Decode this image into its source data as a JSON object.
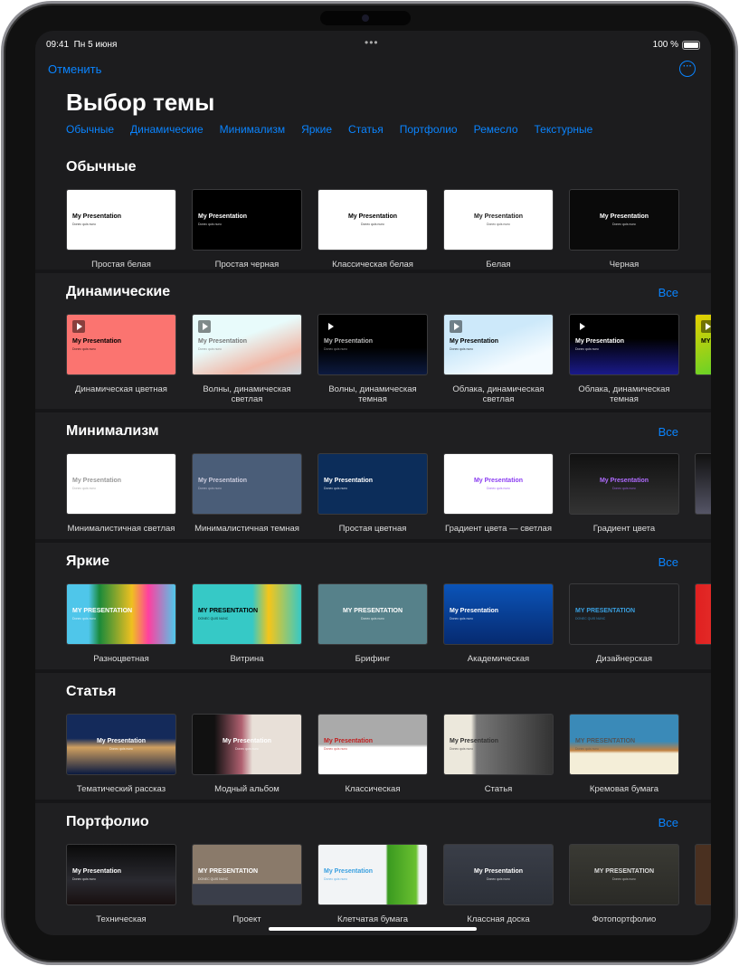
{
  "status": {
    "time": "09:41",
    "date": "Пн 5 июня",
    "dots": "•••",
    "battery": "100 %"
  },
  "nav": {
    "cancel": "Отменить",
    "more_icon": "ellipsis-circle-icon"
  },
  "title": "Выбор темы",
  "categories": [
    "Обычные",
    "Динамические",
    "Минимализм",
    "Яркие",
    "Статья",
    "Портфолио",
    "Ремесло",
    "Текстурные"
  ],
  "all_label": "Все",
  "sections": [
    {
      "title": "Обычные",
      "show_all": false,
      "themes": [
        {
          "label": "Простая белая",
          "bg": "#ffffff",
          "fg": "#000",
          "title": "My Presentation",
          "subtitle": "Donec quis nunc"
        },
        {
          "label": "Простая черная",
          "bg": "#000000",
          "fg": "#fff",
          "title": "My Presentation",
          "subtitle": "Donec quis nunc"
        },
        {
          "label": "Классическая белая",
          "bg": "#ffffff",
          "fg": "#000",
          "title": "My Presentation",
          "subtitle": "Donec quis nunc",
          "center": true
        },
        {
          "label": "Белая",
          "bg": "#ffffff",
          "fg": "#222",
          "title": "My Presentation",
          "subtitle": "Donec quis nunc",
          "center": true
        },
        {
          "label": "Черная",
          "bg": "#0a0a0a",
          "fg": "#fff",
          "title": "My Presentation",
          "subtitle": "Donec quis nunc",
          "center": true
        }
      ]
    },
    {
      "title": "Динамические",
      "show_all": true,
      "themes": [
        {
          "label": "Динамическая цветная",
          "bg": "#fb7470",
          "fg": "#000",
          "title": "My Presentation",
          "subtitle": "Donec quis nunc",
          "play": true
        },
        {
          "label": "Волны, динамическая светлая",
          "bg": "linear-gradient(160deg,#e8fbfb 40%,#f0b8a8 75%,#cfd8de)",
          "fg": "#777",
          "title": "My Presentation",
          "subtitle": "Donec quis nunc",
          "play": true
        },
        {
          "label": "Волны, динамическая темная",
          "bg": "linear-gradient(180deg,#000 55%,#0c1a40)",
          "fg": "#bbb",
          "title": "My Presentation",
          "subtitle": "Donec quis nunc",
          "play": true
        },
        {
          "label": "Облака, динамическая светлая",
          "bg": "linear-gradient(160deg,#cde9fa 40%,#f4fbff 75%)",
          "fg": "#000",
          "title": "My Presentation",
          "subtitle": "Donec quis nunc",
          "play": true
        },
        {
          "label": "Облака, динамическая темная",
          "bg": "linear-gradient(180deg,#000 40%,#1a1a8a)",
          "fg": "#fff",
          "title": "My Presentation",
          "subtitle": "Donec quis nunc",
          "play": true
        },
        {
          "label": "",
          "bg": "linear-gradient(160deg,#e6d000,#2ad33a)",
          "fg": "#000",
          "title": "MY",
          "subtitle": "",
          "play": true
        }
      ]
    },
    {
      "title": "Минимализм",
      "show_all": true,
      "themes": [
        {
          "label": "Минималистичная светлая",
          "bg": "#ffffff",
          "fg": "#999",
          "title": "My Presentation",
          "subtitle": "Donec quis nunc"
        },
        {
          "label": "Минималистичная темная",
          "bg": "#4a5d78",
          "fg": "#ccd",
          "title": "My Presentation",
          "subtitle": "Donec quis nunc"
        },
        {
          "label": "Простая цветная",
          "bg": "#0c2d5a",
          "fg": "#fff",
          "title": "My Presentation",
          "subtitle": "Donec quis nunc"
        },
        {
          "label": "Градиент цвета — светлая",
          "bg": "#ffffff",
          "fg": "#8a3cf0",
          "title": "My Presentation",
          "subtitle": "Donec quis nunc",
          "center": true
        },
        {
          "label": "Градиент цвета",
          "bg": "linear-gradient(180deg,#111,#333)",
          "fg": "#b06cff",
          "title": "My Presentation",
          "subtitle": "Donec quis nunc",
          "center": true
        },
        {
          "label": "",
          "bg": "linear-gradient(180deg,#111,#556)",
          "fg": "#fff",
          "title": "",
          "subtitle": ""
        }
      ]
    },
    {
      "title": "Яркие",
      "show_all": true,
      "themes": [
        {
          "label": "Разноцветная",
          "bg": "linear-gradient(90deg,#4fc6ea 20%,#1a8a3a 30%,#f0c020 60%,#ff3fa0 75%,#50c8ea)",
          "fg": "#fff",
          "title": "MY PRESENTATION",
          "subtitle": "Donec quis nunc"
        },
        {
          "label": "Витрина",
          "bg": "linear-gradient(90deg,#36c9c6 55%,#f5c51a 70%,#36c9c6)",
          "fg": "#000",
          "title": "MY PRESENTATION",
          "subtitle": "DONEC QUIS NUNC"
        },
        {
          "label": "Брифинг",
          "bg": "#56818a",
          "fg": "#fff",
          "title": "MY PRESENTATION",
          "subtitle": "Donec quis nunc",
          "center": true
        },
        {
          "label": "Академическая",
          "bg": "linear-gradient(180deg,#0b54b8,#062a70)",
          "fg": "#fff",
          "title": "My Presentation",
          "subtitle": "Donec quis nunc"
        },
        {
          "label": "Дизайнерская",
          "bg": "#1e1e20",
          "fg": "#3aa0e0",
          "title": "MY PRESENTATION",
          "subtitle": "DONEC QUIS NUNC"
        },
        {
          "label": "",
          "bg": "linear-gradient(90deg,#e02020,#f06050)",
          "fg": "#fff",
          "title": "",
          "subtitle": ""
        }
      ]
    },
    {
      "title": "Статья",
      "show_all": false,
      "themes": [
        {
          "label": "Тематический рассказ",
          "bg": "linear-gradient(180deg,#142a5a 40%,#d0a060 55%,#0a1a40)",
          "fg": "#fff",
          "title": "My Presentation",
          "subtitle": "Donec quis nunc",
          "center": true
        },
        {
          "label": "Модный альбом",
          "bg": "linear-gradient(90deg,#111 20%,#b06070 45%,#e8e0d8 55%)",
          "fg": "#fff",
          "title": "My Presentation",
          "subtitle": "Donec quis nunc",
          "center": true
        },
        {
          "label": "Классическая",
          "bg": "linear-gradient(180deg,#aaa 50%,#fff 55%)",
          "fg": "#c02020",
          "title": "My Presentation",
          "subtitle": "Donec quis nunc"
        },
        {
          "label": "Статья",
          "bg": "linear-gradient(90deg,#ece8dc 25%,#777 30%,#333)",
          "fg": "#333",
          "title": "My Presentation",
          "subtitle": "Donec quis nunc"
        },
        {
          "label": "Кремовая бумага",
          "bg": "linear-gradient(180deg,#3a8ab8 45%,#c08040 60%,#f4eed8 65%)",
          "fg": "#555",
          "title": "MY PRESENTATION",
          "subtitle": "Donec quis nunc"
        }
      ]
    },
    {
      "title": "Портфолио",
      "show_all": true,
      "themes": [
        {
          "label": "Техническая",
          "bg": "linear-gradient(180deg,#0a0a0a,#2a2a30 60%,#181010)",
          "fg": "#fff",
          "title": "My Presentation",
          "subtitle": "Donec quis nunc"
        },
        {
          "label": "Проект",
          "bg": "linear-gradient(180deg,#8a7a6a 65%,#3a3e4a 66%)",
          "fg": "#fff",
          "title": "MY PRESENTATION",
          "subtitle": "DONEC QUIS NUNC"
        },
        {
          "label": "Клетчатая бумага",
          "bg": "linear-gradient(90deg,#f2f4f6 62%,#3a9a20 64%,#6ac030 90%,#f2f4f6 93%)",
          "fg": "#3aa0e0",
          "title": "My Presentation",
          "subtitle": "Donec quis nunc"
        },
        {
          "label": "Классная доска",
          "bg": "linear-gradient(180deg,#3a3e48,#2c3038)",
          "fg": "#fff",
          "title": "My Presentation",
          "subtitle": "Donec quis nunc",
          "center": true
        },
        {
          "label": "Фотопортфолио",
          "bg": "linear-gradient(180deg,#3a3a34,#2a2a26)",
          "fg": "#ddd",
          "title": "MY PRESENTATION",
          "subtitle": "Donec quis nunc",
          "center": true
        },
        {
          "label": "",
          "bg": "#4a3020",
          "fg": "#fff",
          "title": "",
          "subtitle": ""
        }
      ]
    }
  ]
}
